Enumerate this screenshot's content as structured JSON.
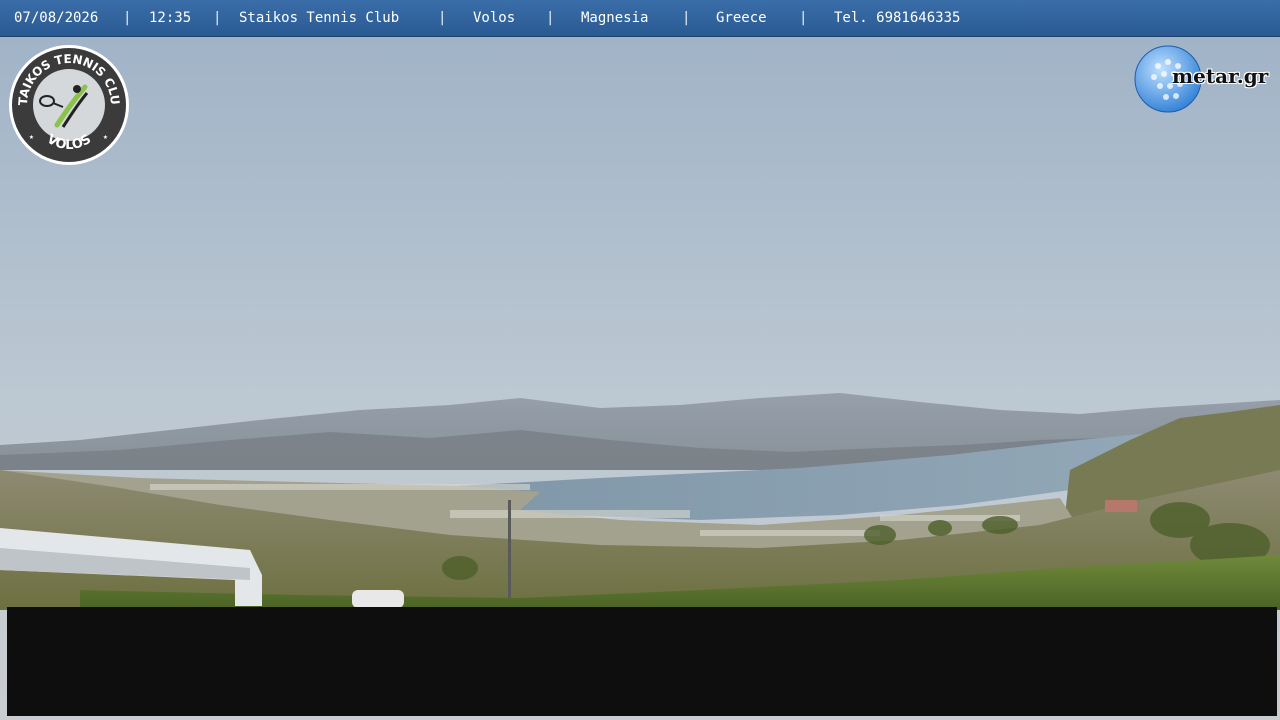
{
  "header": {
    "date": "07/08/2026",
    "time": "12:35",
    "club": "Staikos Tennis Club",
    "city": "Volos",
    "region": "Magnesia",
    "country": "Greece",
    "phone": "Tel. 6981646335",
    "separator": "|"
  },
  "logo_left": {
    "top_text": "STAIKOS TENNIS CLUB",
    "bottom_text": "VOLOS"
  },
  "logo_right": {
    "text": "metar.gr"
  },
  "colors": {
    "header_bg": "#2f639c",
    "sky": "#b7c4cf",
    "sea": "#7e98ac",
    "bottom_panel": "#0e0e0e"
  }
}
